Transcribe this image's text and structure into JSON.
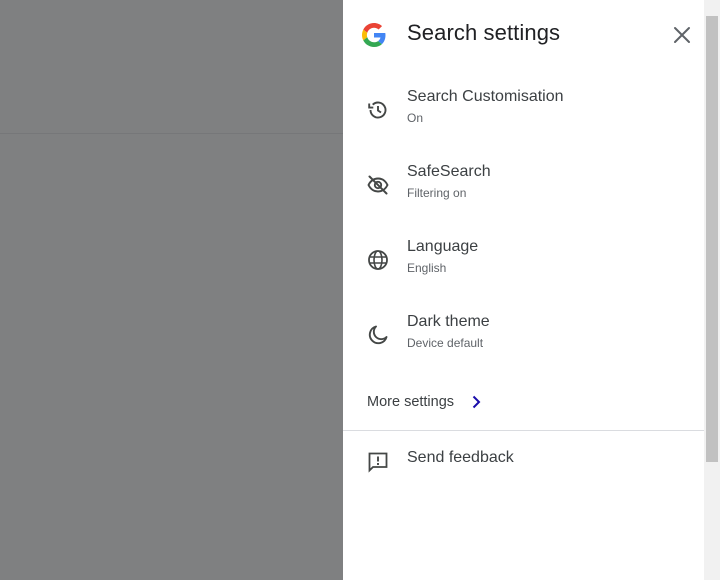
{
  "panel": {
    "title": "Search settings",
    "close_icon": "close-icon",
    "logo_icon": "google-g-logo"
  },
  "settings": [
    {
      "label": "Search Customisation",
      "sub": "On",
      "icon": "history-icon"
    },
    {
      "label": "SafeSearch",
      "sub": "Filtering on",
      "icon": "eye-off-icon"
    },
    {
      "label": "Language",
      "sub": "English",
      "icon": "globe-icon"
    },
    {
      "label": "Dark theme",
      "sub": "Device default",
      "icon": "moon-icon"
    }
  ],
  "more_settings": {
    "label": "More settings",
    "icon": "chevron-right-icon",
    "accent": "#1a0dab"
  },
  "feedback": {
    "label": "Send feedback",
    "icon": "feedback-icon"
  },
  "colors": {
    "backdrop": "#7f8081",
    "text_primary": "#202124",
    "text_secondary": "#5f6368",
    "icon": "#444746"
  }
}
